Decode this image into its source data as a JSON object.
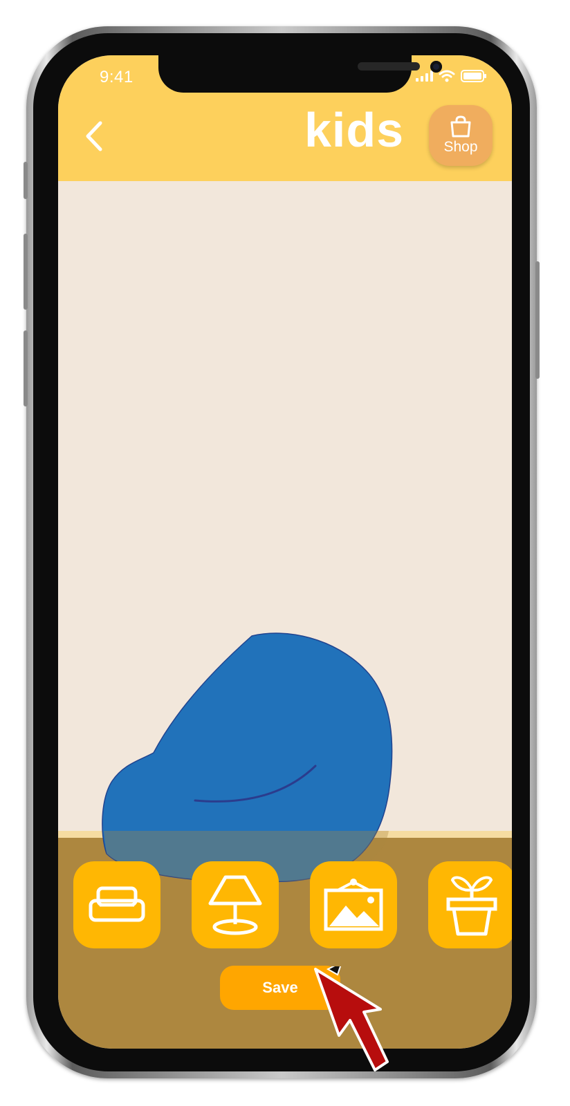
{
  "status_bar": {
    "time": "9:41",
    "icons": [
      "cellular-signal-icon",
      "wifi-icon",
      "battery-icon"
    ]
  },
  "header": {
    "back_icon": "chevron-left-icon",
    "logo": "kids",
    "shop": {
      "icon": "shopping-bag-icon",
      "label": "Shop"
    }
  },
  "canvas": {
    "placed_items": [
      {
        "name": "bean-bag-chair",
        "color": "#2172ba"
      }
    ]
  },
  "toolbar": {
    "tools": [
      {
        "name": "sofa",
        "icon": "sofa-icon"
      },
      {
        "name": "lamp",
        "icon": "lamp-icon"
      },
      {
        "name": "wall-picture",
        "icon": "picture-frame-icon"
      },
      {
        "name": "plant",
        "icon": "plant-pot-icon"
      }
    ],
    "save_label": "Save"
  },
  "colors": {
    "header": "#fdd05c",
    "wall": "#f2e7db",
    "floor": "#ad873f",
    "tool_button": "#ffb703",
    "save_button": "#ffa600",
    "shop_button": "#f0ad5e",
    "cursor": "#b70d0d"
  }
}
